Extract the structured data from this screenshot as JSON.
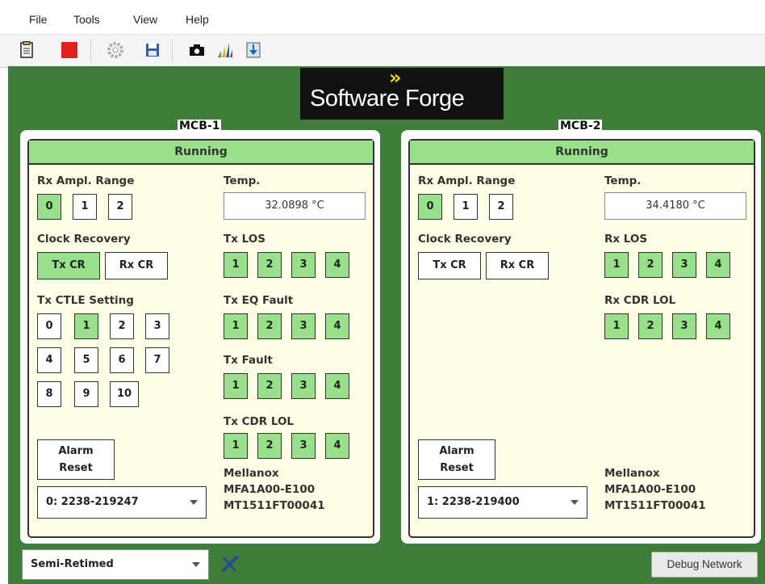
{
  "menu": [
    "File",
    "Tools",
    "View",
    "Help"
  ],
  "toolbar": {
    "icons": [
      "notepad-icon",
      "stop-icon",
      "settings-icon",
      "save-icon",
      "camera-icon",
      "chart-icon",
      "download-icon"
    ],
    "stop_color": "#e0201b"
  },
  "logo": {
    "chevrons": "»",
    "text": "Software Forge"
  },
  "colors": {
    "workspace": "#3e7d3a",
    "active": "#98e08a",
    "panel_inner": "#fffde6"
  },
  "mcb1": {
    "title": "MCB-1",
    "status": "Running",
    "rx_ampl_label": "Rx Ampl. Range",
    "rx_ampl": [
      "0",
      "1",
      "2"
    ],
    "clock_label": "Clock Recovery",
    "clock": [
      "Tx CR",
      "Rx CR"
    ],
    "ctle_label": "Tx CTLE Setting",
    "ctle": [
      "0",
      "1",
      "2",
      "3",
      "4",
      "5",
      "6",
      "7",
      "8",
      "9",
      "10"
    ],
    "temp_label": "Temp.",
    "temp": "32.0898 °C",
    "g1_label": "Tx LOS",
    "g2_label": "Tx EQ Fault",
    "g3_label": "Tx Fault",
    "g4_label": "Tx CDR LOL",
    "channels": [
      "1",
      "2",
      "3",
      "4"
    ],
    "alarm": [
      "Alarm",
      "Reset"
    ],
    "device": "0: 2238-219247",
    "vendor": "Mellanox",
    "part": "MFA1A00-E100",
    "serial": "MT1511FT00041"
  },
  "mcb2": {
    "title": "MCB-2",
    "status": "Running",
    "rx_ampl_label": "Rx Ampl. Range",
    "rx_ampl": [
      "0",
      "1",
      "2"
    ],
    "clock_label": "Clock Recovery",
    "clock": [
      "Tx CR",
      "Rx CR"
    ],
    "temp_label": "Temp.",
    "temp": "34.4180 °C",
    "g1_label": "Rx LOS",
    "g2_label": "Rx CDR LOL",
    "channels": [
      "1",
      "2",
      "3",
      "4"
    ],
    "alarm": [
      "Alarm",
      "Reset"
    ],
    "device": "1: 2238-219400",
    "vendor": "Mellanox",
    "part": "MFA1A00-E100",
    "serial": "MT1511FT00041"
  },
  "mode": "Semi-Retimed",
  "debug_label": "Debug Network"
}
